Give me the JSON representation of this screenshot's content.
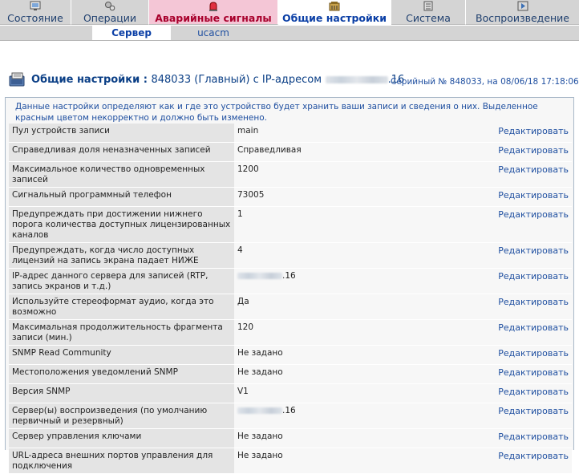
{
  "tabs": [
    {
      "label": "Состояние",
      "icon": "status-icon"
    },
    {
      "label": "Операции",
      "icon": "operations-icon"
    },
    {
      "label": "Аварийные сигналы",
      "icon": "alarm-icon"
    },
    {
      "label": "Общие настройки",
      "icon": "settings-icon"
    },
    {
      "label": "Система",
      "icon": "system-icon"
    },
    {
      "label": "Воспроизведение",
      "icon": "playback-icon"
    }
  ],
  "subtabs": [
    {
      "label": "Сервер"
    },
    {
      "label": "ucacm"
    }
  ],
  "header": {
    "title": "Общие настройки :",
    "unit_prefix": "848033 (Главный) с IP-адресом",
    "unit_suffix": ".16",
    "serial": "Серийный № 848033, на 08/06/18 17:18:06"
  },
  "description": "Данные настройки определяют как и где это устройство будет хранить ваши записи и сведения о них. Выделенное красным цветом некорректно и должно быть изменено.",
  "edit_label": "Редактировать",
  "rows": [
    {
      "label": "Пул устройств записи",
      "value": "main"
    },
    {
      "label": "Справедливая доля неназначенных записей",
      "value": "Справедливая"
    },
    {
      "label": "Максимальное количество одновременных записей",
      "value": "1200"
    },
    {
      "label": "Сигнальный программный телефон",
      "value": "73005"
    },
    {
      "label": "Предупреждать при достижении нижнего порога количества доступных лицензированных каналов",
      "value": "1"
    },
    {
      "label": "Предупреждать, когда число доступных лицензий на запись экрана падает НИЖЕ",
      "value": "4"
    },
    {
      "label": "IP-адрес данного сервера для записей (RTP, запись экранов и т.д.)",
      "value": ".16"
    },
    {
      "label": "Используйте стереоформат аудио, когда это возможно",
      "value": "Да"
    },
    {
      "label": "Максимальная продолжительность фрагмента записи (мин.)",
      "value": "120"
    },
    {
      "label": "SNMP Read Community",
      "value": "Не задано"
    },
    {
      "label": "Местоположения уведомлений SNMP",
      "value": "Не задано"
    },
    {
      "label": "Версия SNMP",
      "value": "V1"
    },
    {
      "label": "Сервер(ы) воспроизведения (по умолчанию первичный и резервный)",
      "value": ".16"
    },
    {
      "label": "Сервер управления ключами",
      "value": "Не задано"
    },
    {
      "label": "URL-адреса внешних портов управления для подключения",
      "value": "Не задано"
    }
  ]
}
